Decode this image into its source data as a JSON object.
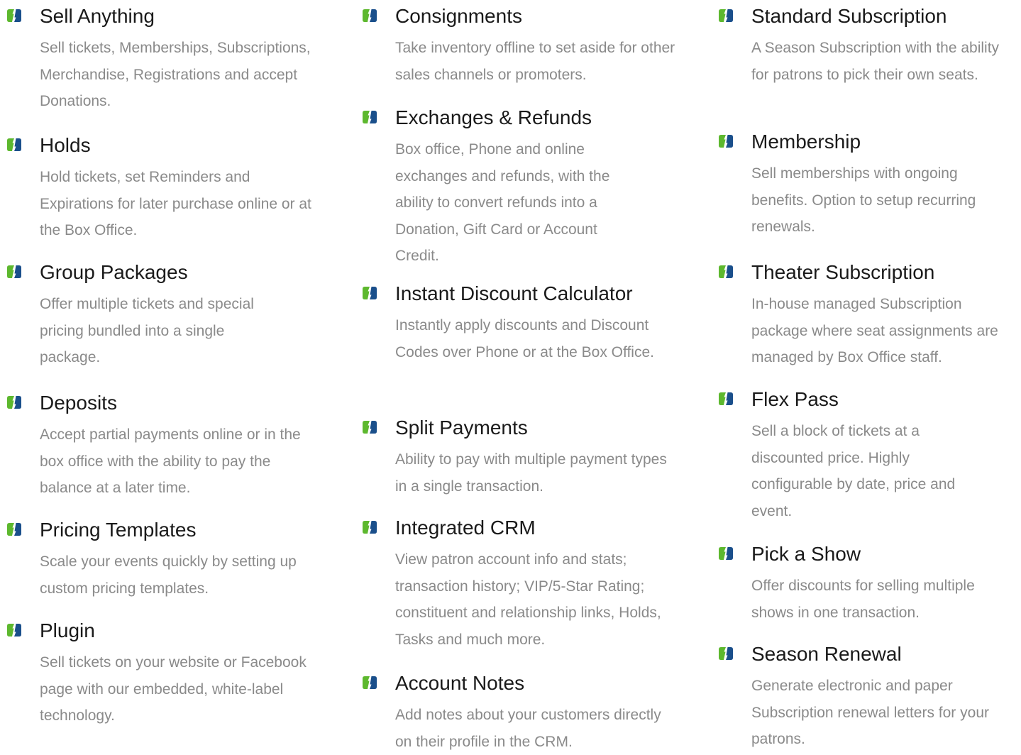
{
  "colors": {
    "icon_green": "#5db82e",
    "icon_blue": "#1a4f8b",
    "title_text": "#1a1a1a",
    "description_text": "#8a8a8a"
  },
  "icon_name": "feature-bullet-icon",
  "columns": [
    {
      "features": [
        {
          "title": "Sell Anything",
          "description": "Sell tickets, Memberships, Subscriptions, Merchandise, Registrations and accept Donations."
        },
        {
          "title": "Holds",
          "description": "Hold tickets, set Reminders and Expirations for later purchase online or at the Box Office."
        },
        {
          "title": "Group Packages",
          "description": "Offer multiple tickets and special pricing bundled into a single package."
        },
        {
          "title": "Deposits",
          "description": "Accept partial payments online or in the box office with the ability to pay the balance at a later time."
        },
        {
          "title": "Pricing Templates",
          "description": "Scale your events quickly by setting up custom pricing templates."
        },
        {
          "title": "Plugin",
          "description": "Sell tickets on your website or Facebook page with our embedded, white-label technology."
        }
      ]
    },
    {
      "features": [
        {
          "title": "Consignments",
          "description": "Take inventory offline to set aside for other sales channels or promoters."
        },
        {
          "title": "Exchanges & Refunds",
          "description": "Box office, Phone and online exchanges and refunds, with the ability to convert refunds into a Donation, Gift Card or Account Credit."
        },
        {
          "title": "Instant Discount Calculator",
          "description": "Instantly apply discounts and Discount Codes over Phone or at the Box Office."
        },
        {
          "title": "Split Payments",
          "description": "Ability to pay with multiple payment types in a single transaction."
        },
        {
          "title": "Integrated CRM",
          "description": "View patron account info and stats; transaction history; VIP/5-Star Rating; constituent and relationship links, Holds, Tasks and much more."
        },
        {
          "title": "Account Notes",
          "description": "Add notes about your customers directly on their profile in the CRM."
        }
      ]
    },
    {
      "features": [
        {
          "title": "Standard Subscription",
          "description": "A Season Subscription with the ability for patrons to pick their own seats."
        },
        {
          "title": "Membership",
          "description": "Sell memberships with ongoing benefits. Option to setup recurring renewals."
        },
        {
          "title": "Theater Subscription",
          "description": "In-house managed Subscription package where seat assignments are managed by Box Office staff."
        },
        {
          "title": "Flex Pass",
          "description": "Sell a block of tickets at a discounted price. Highly configurable by date, price and event."
        },
        {
          "title": "Pick a Show",
          "description": "Offer discounts for selling multiple shows in one transaction."
        },
        {
          "title": "Season Renewal",
          "description": "Generate electronic and paper Subscription renewal letters for your patrons."
        }
      ]
    }
  ]
}
